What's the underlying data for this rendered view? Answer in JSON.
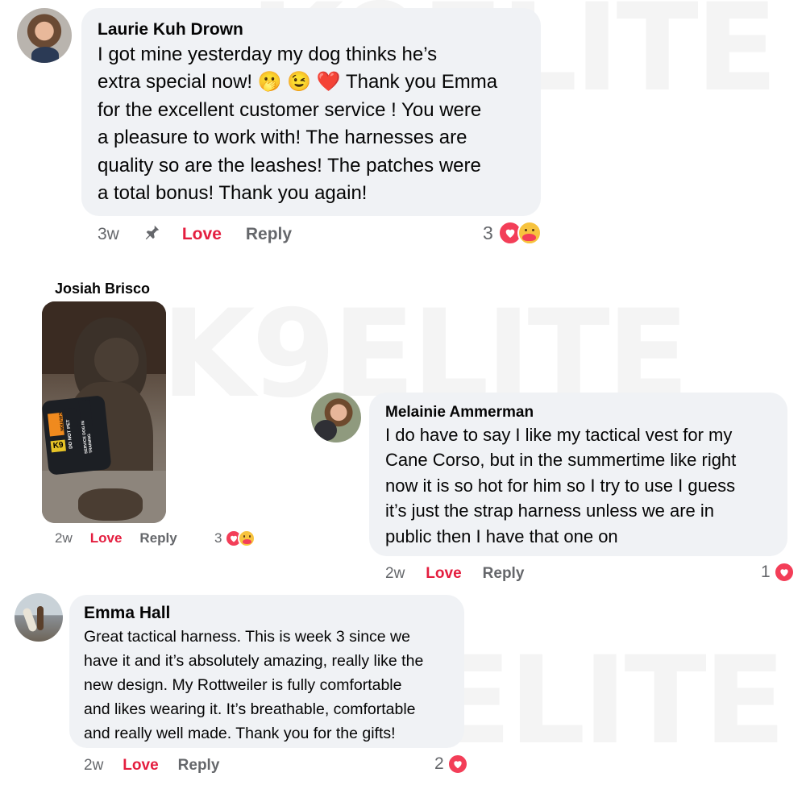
{
  "watermark": "K9ELITE",
  "comments": [
    {
      "author": "Laurie Kuh Drown",
      "text_lines": [
        "I got mine yesterday my dog thinks he’s",
        "extra special now! 🫢 😉 ❤️ Thank you Emma",
        "for the excellent customer service ! You were",
        "a pleasure to work with! The harnesses are",
        "quality so are the leashes! The patches were",
        "a total bonus! Thank you again!"
      ],
      "time": "3w",
      "love": "Love",
      "reply": "Reply",
      "reaction_count": "3"
    },
    {
      "author": "Josiah Brisco",
      "time": "2w",
      "love": "Love",
      "reply": "Reply",
      "reaction_count": "3",
      "photo": {
        "patch_top": "CAUTION",
        "patch_mid": "DO NOT PET",
        "patch_side": "SERVICE DOG IN TRAINING",
        "patch_id": "K9"
      }
    },
    {
      "author": "Melainie Ammerman",
      "text_lines": [
        "I do have to say I like my tactical vest for my",
        "Cane Corso, but in the summertime like right",
        "now it is so hot for him so I try to use I guess",
        "it’s just the strap harness unless we are in",
        "public then I have that one on"
      ],
      "time": "2w",
      "love": "Love",
      "reply": "Reply",
      "reaction_count": "1"
    },
    {
      "author": "Emma Hall",
      "text_lines": [
        "Great tactical harness. This is week 3 since we",
        "have it and it’s absolutely amazing, really like the",
        "new design. My Rottweiler is fully comfortable",
        "and likes wearing it. It’s breathable, comfortable",
        "and really well made. Thank you for the gifts!"
      ],
      "time": "2w",
      "love": "Love",
      "reply": "Reply",
      "reaction_count": "2"
    }
  ],
  "colors": {
    "bubble": "#f0f2f5",
    "love_red": "#e41e3f",
    "heart": "#f33e58",
    "meta_gray": "#65676b"
  },
  "icons": [
    "pin-icon",
    "heart-reaction-icon",
    "care-reaction-icon"
  ]
}
